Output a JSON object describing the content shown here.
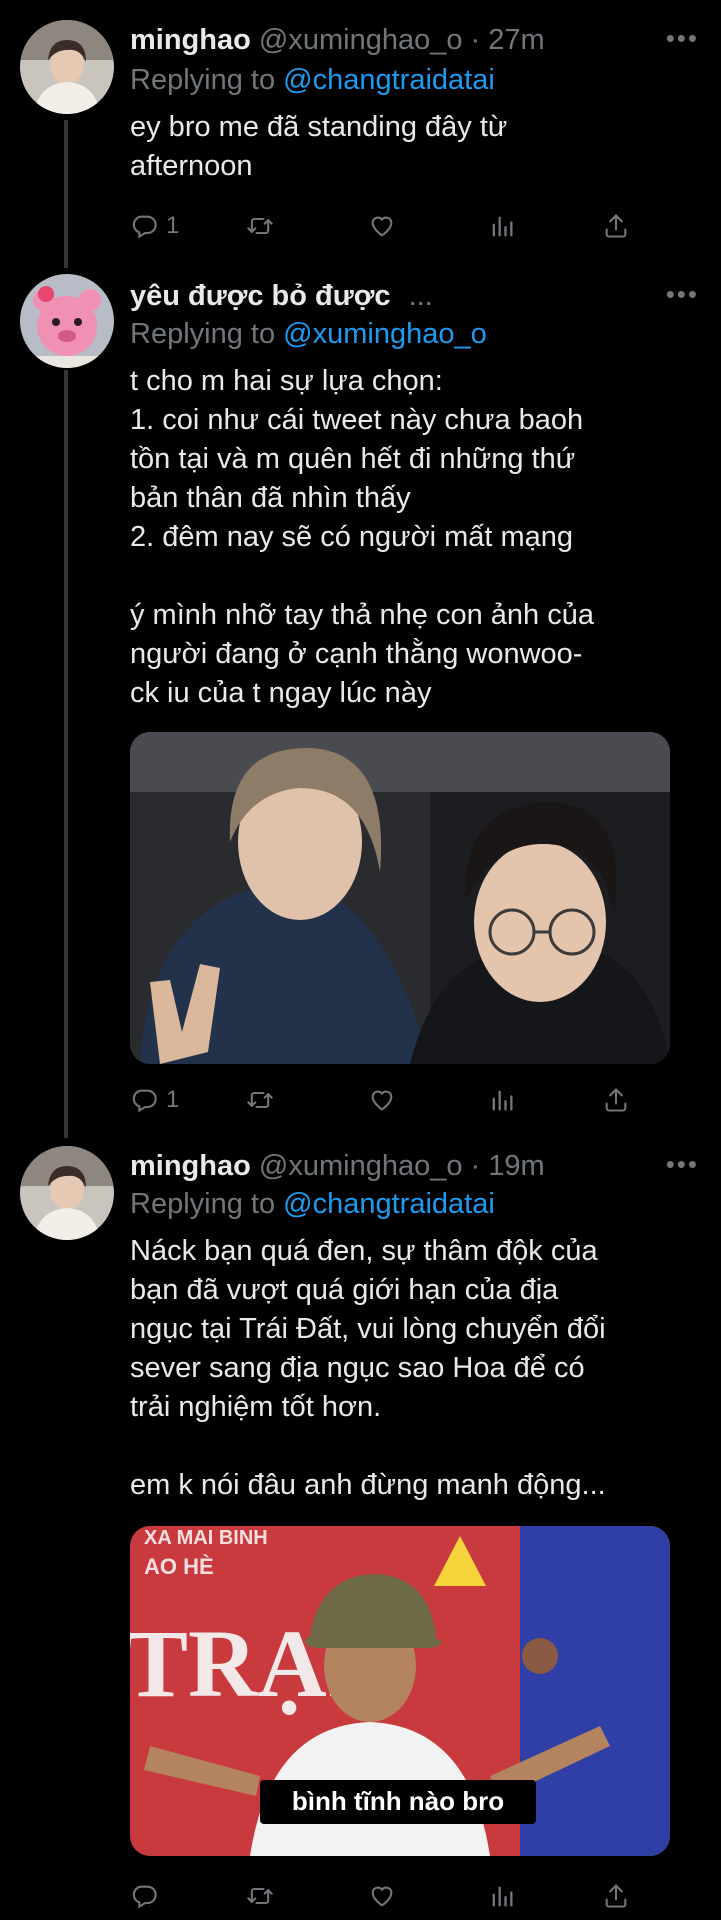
{
  "tweets": [
    {
      "name": "minghao",
      "handle": "@xuminghao_o",
      "separator": "·",
      "time": "27m",
      "replying_prefix": "Replying to",
      "replying_to": "@changtraidatai",
      "text": "ey bro me đã standing đây từ\nafternoon",
      "reply_count": "1",
      "more": "•••"
    },
    {
      "name": "yêu được bỏ được",
      "name_suffix": "...",
      "replying_prefix": "Replying to",
      "replying_to": "@xuminghao_o",
      "text": "t cho m hai sự lựa chọn:\n1. coi như cái tweet này chưa baoh\ntồn tại và m quên hết đi những thứ\nbản thân đã nhìn thấy\n2. đêm nay sẽ có người mất mạng\n\ný mình nhỡ tay thả nhẹ con ảnh của\nngười đang ở cạnh thằng wonwoo-\nck iu của t ngay lúc này",
      "reply_count": "1",
      "more": "•••"
    },
    {
      "name": "minghao",
      "handle": "@xuminghao_o",
      "separator": "·",
      "time": "19m",
      "replying_prefix": "Replying to",
      "replying_to": "@changtraidatai",
      "text": "Náck bạn quá đen, sự thâm độk của\nbạn đã vượt quá giới hạn của địa\nngục tại Trái Đất, vui lòng chuyển đổi\nsever sang địa ngục sao Hoa để có\ntrải nghiệm tốt hơn.\n\nem k nói đâu anh đừng manh động...",
      "media_caption": "bình tĩnh nào bro",
      "media_sign_top": "XA MAI BINH",
      "media_sign_top2": "AO HÈ",
      "media_sign_big": "TRẠI",
      "more": "•••"
    }
  ],
  "icons": {
    "reply": "reply-icon",
    "retweet": "retweet-icon",
    "like": "heart-icon",
    "analytics": "analytics-icon",
    "share": "share-icon"
  },
  "colors": {
    "background": "#000000",
    "text": "#e7e9ea",
    "muted": "#71767b",
    "link": "#1d9bf0"
  }
}
